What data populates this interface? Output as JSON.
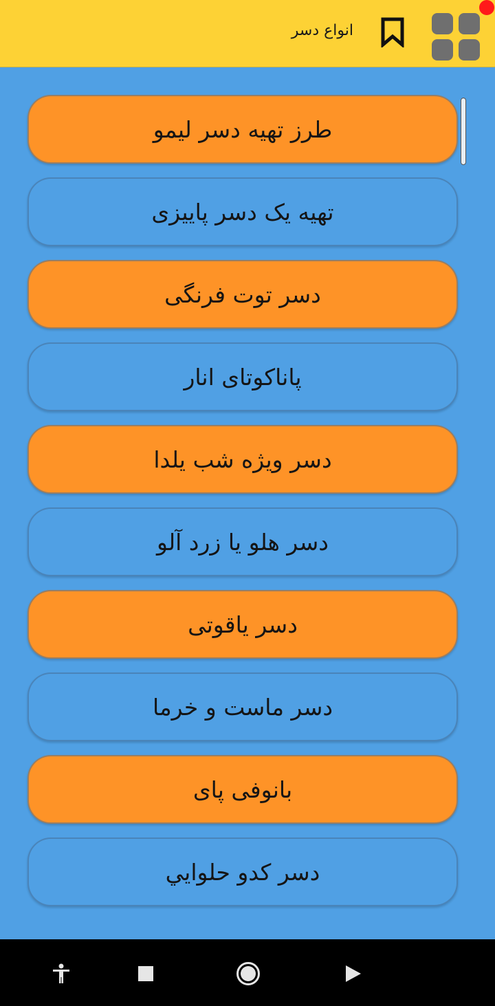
{
  "app_bar": {
    "title": "انواع دسر",
    "bookmark_icon": "bookmark-icon",
    "menu_icon": "grid-menu-icon",
    "notification_color": "#ff1a1a",
    "background_color": "#fdd235"
  },
  "list": {
    "items": [
      {
        "label": "طرز تهیه دسر لیمو",
        "style": "orange"
      },
      {
        "label": "تهیه یک دسر پاییزی",
        "style": "blue"
      },
      {
        "label": "دسر توت فرنگی",
        "style": "orange"
      },
      {
        "label": "پاناکوتای انار",
        "style": "blue"
      },
      {
        "label": "دسر ویژه شب یلدا",
        "style": "orange"
      },
      {
        "label": "دسر هلو یا زرد آلو",
        "style": "blue"
      },
      {
        "label": "دسر یاقوتی",
        "style": "orange"
      },
      {
        "label": "دسر ماست و خرما",
        "style": "blue"
      },
      {
        "label": "بانوفی پای",
        "style": "orange"
      },
      {
        "label": "دسر کدو حلوايي",
        "style": "blue"
      }
    ],
    "orange_color": "#fe9327",
    "blue_color": "#50a0e4"
  },
  "nav_bar": {
    "icons": [
      "accessibility-icon",
      "recents-icon",
      "home-icon",
      "back-icon"
    ]
  }
}
